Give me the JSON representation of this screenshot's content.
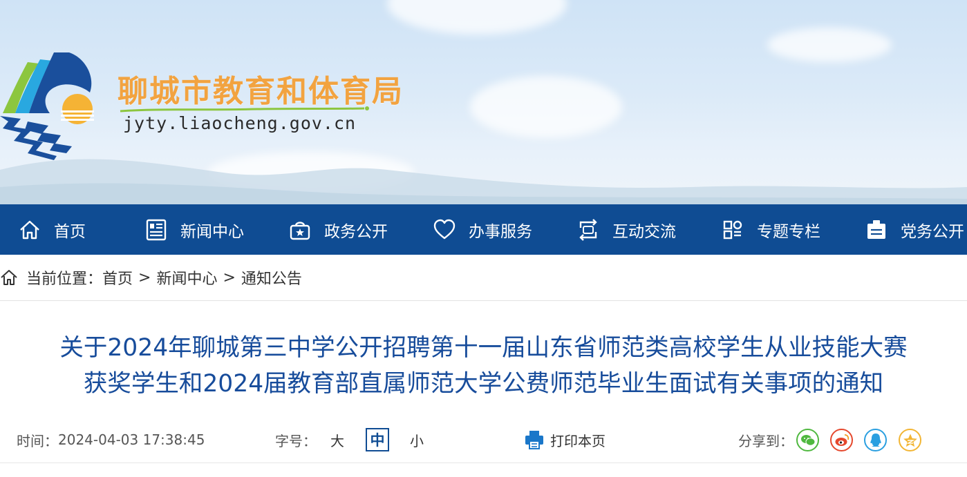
{
  "site": {
    "title": "聊城市教育和体育局",
    "url": "jyty.liaocheng.gov.cn"
  },
  "nav": {
    "items": [
      {
        "label": "首页",
        "icon": "home-icon"
      },
      {
        "label": "新闻中心",
        "icon": "news-icon"
      },
      {
        "label": "政务公开",
        "icon": "government-icon"
      },
      {
        "label": "办事服务",
        "icon": "heart-icon"
      },
      {
        "label": "互动交流",
        "icon": "exchange-icon"
      },
      {
        "label": "专题专栏",
        "icon": "grid-icon"
      },
      {
        "label": "党务公开",
        "icon": "party-icon"
      }
    ]
  },
  "breadcrumb": {
    "prefix": "当前位置：",
    "items": [
      "首页",
      "新闻中心",
      "通知公告"
    ],
    "separator": ">"
  },
  "article": {
    "title_line1": "关于2024年聊城第三中学公开招聘第十一届山东省师范类高校学生从业技能大赛",
    "title_line2": "获奖学生和2024届教育部直属师范大学公费师范毕业生面试有关事项的通知"
  },
  "meta": {
    "time_label": "时间：",
    "time_value": "2024-04-03 17:38:45",
    "font_size_label": "字号：",
    "size_large": "大",
    "size_medium": "中",
    "size_small": "小",
    "print_label": "打印本页",
    "share_label": "分享到："
  },
  "share": [
    "wechat-icon",
    "weibo-icon",
    "qq-icon",
    "qzone-icon"
  ],
  "colors": {
    "nav_bg": "#0f4c93",
    "title_blue": "#174c9b",
    "site_title_orange": "#f2a340"
  }
}
